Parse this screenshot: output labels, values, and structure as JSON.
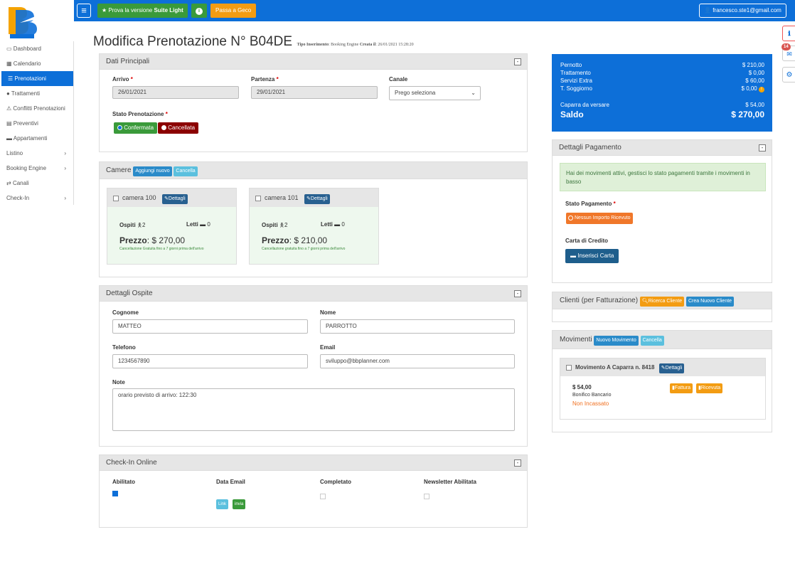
{
  "topbar": {
    "suite_label": "Prova la versione",
    "suite_strong": "Suite Light",
    "geco_label": "Passa a Geco",
    "user_email": "francesco.ste1@gmail.com"
  },
  "sidebar": {
    "items": [
      {
        "label": "Dashboard"
      },
      {
        "label": "Calendario"
      },
      {
        "label": "Prenotazioni"
      },
      {
        "label": "Trattamenti"
      },
      {
        "label": "Conflitti Prenotazioni"
      },
      {
        "label": "Preventivi"
      },
      {
        "label": "Appartamenti"
      },
      {
        "label": "Listino"
      },
      {
        "label": "Booking Engine"
      },
      {
        "label": "Canali"
      },
      {
        "label": "Check-In"
      }
    ]
  },
  "page": {
    "title": "Modifica Prenotazione N° B04DE",
    "meta_tipo_label": "Tipo Inserimento",
    "meta_tipo_value": ": Booking Engine",
    "meta_creata_label": "Creata il",
    "meta_creata_value": ": 26/01/2021 15:28:20"
  },
  "dati_principali": {
    "title": "Dati Principali",
    "arrivo_label": "Arrivo",
    "arrivo_value": "26/01/2021",
    "partenza_label": "Partenza",
    "partenza_value": "29/01/2021",
    "canale_label": "Canale",
    "canale_value": "Prego seleziona",
    "stato_label": "Stato Prenotazione",
    "confermata": "Confermata",
    "cancellata": "Cancellata"
  },
  "camere": {
    "title": "Camere",
    "add_label": "Aggiungi nuovo",
    "cancel_label": "Cancella",
    "rooms": [
      {
        "name": "camera 100",
        "details": "Dettagli",
        "ospiti_label": "Ospiti",
        "ospiti": "2",
        "letti_label": "Letti",
        "letti": "0",
        "prezzo_label": "Prezzo",
        "prezzo": ": $ 270,00",
        "note": "Cancellazione Gratuita fino a 7 giorni prima dell'arrivo"
      },
      {
        "name": "camera 101",
        "details": "Dettagli",
        "ospiti_label": "Ospiti",
        "ospiti": "2",
        "letti_label": "Letti",
        "letti": "0",
        "prezzo_label": "Prezzo",
        "prezzo": ": $ 210,00",
        "note": "Cancellazione gratuita fino a 7 giorni prima dell'arrivo"
      }
    ]
  },
  "ospite": {
    "title": "Dettagli Ospite",
    "cognome_label": "Cognome",
    "cognome": "MATTEO",
    "nome_label": "Nome",
    "nome": "PARROTTO",
    "telefono_label": "Telefono",
    "telefono": "1234567890",
    "email_label": "Email",
    "email": "sviluppo@bbplanner.com",
    "note_label": "Note",
    "note": "orario previsto di arrivo: 122:30"
  },
  "checkin": {
    "title": "Check-In Online",
    "abilitato": "Abilitato",
    "data_email": "Data Email",
    "completato": "Completato",
    "newsletter": "Newsletter Abilitata",
    "link_label": "Link",
    "invia_label": "invia"
  },
  "summary": {
    "rows": [
      {
        "label": "Pernotto",
        "value": "$ 210,00"
      },
      {
        "label": "Trattamento",
        "value": "$ 0,00"
      },
      {
        "label": "Servizi Extra",
        "value": "$ 60,00"
      },
      {
        "label": "T. Soggiorno",
        "value": "$ 0,00"
      }
    ],
    "caparra_label": "Caparra da versare",
    "caparra_value": "$ 54,00",
    "saldo_label": "Saldo",
    "saldo_value": "$ 270,00"
  },
  "pagamento": {
    "title": "Dettagli Pagamento",
    "alert": "Hai dei movimenti attivi, gestisci lo stato pagamenti tramite i movimenti in basso",
    "stato_label": "Stato Pagamento",
    "stato_value": "Nessun Importo Ricevuto",
    "carta_label": "Carta di Credito",
    "carta_button": "Inserisci Carta"
  },
  "clienti": {
    "title": "Clienti (per Fatturazione)",
    "search_label": "Ricerca Cliente",
    "new_label": "Crea Nuovo Cliente"
  },
  "movimenti": {
    "title": "Movimenti",
    "new_label": "Nuovo Movimento",
    "cancel_label": "Cancella",
    "item_title": "Movimento A Caparra n. 8418",
    "details": "Dettagli",
    "amount": "$ 54,00",
    "method": "Bonifico Bancario",
    "status": "Non Incassato",
    "fattura": "Fattura",
    "ricevuta": "Ricevuta"
  },
  "right_badge": "14"
}
